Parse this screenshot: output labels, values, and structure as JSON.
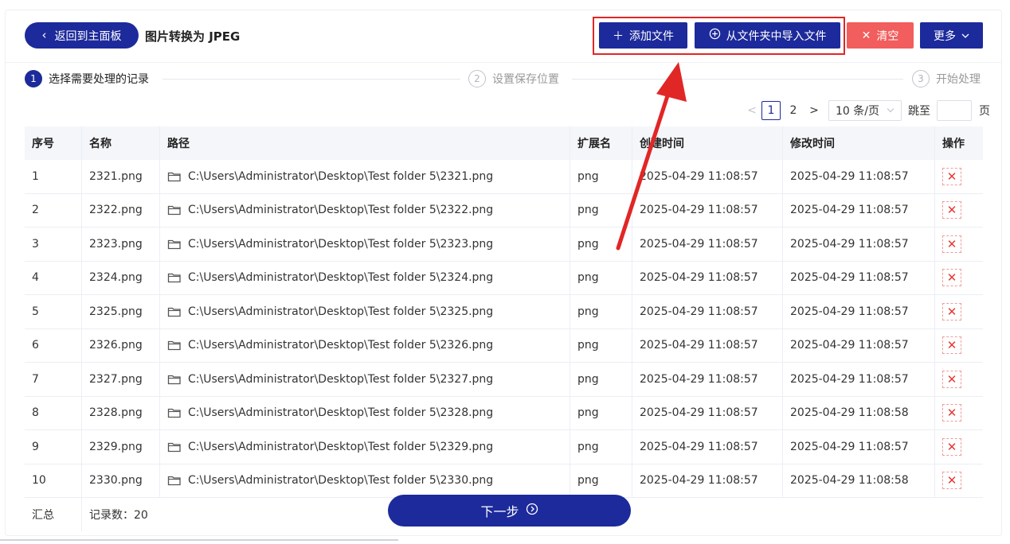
{
  "header": {
    "back_label": "返回到主面板",
    "title": "图片转换为 JPEG",
    "add_file_label": "添加文件",
    "import_folder_label": "从文件夹中导入文件",
    "clear_label": "清空",
    "more_label": "更多"
  },
  "steps": [
    {
      "num": "1",
      "label": "选择需要处理的记录"
    },
    {
      "num": "2",
      "label": "设置保存位置"
    },
    {
      "num": "3",
      "label": "开始处理"
    }
  ],
  "pagination": {
    "prev": "<",
    "pages": [
      "1",
      "2"
    ],
    "current": "1",
    "next": ">",
    "page_size": "10 条/页",
    "jump_label": "跳至",
    "jump_value": "",
    "unit": "页"
  },
  "table": {
    "columns": [
      "序号",
      "名称",
      "路径",
      "扩展名",
      "创建时间",
      "修改时间",
      "操作"
    ],
    "rows": [
      {
        "no": "1",
        "name": "2321.png",
        "path": "C:\\Users\\Administrator\\Desktop\\Test folder 5\\2321.png",
        "ext": "png",
        "created": "2025-04-29 11:08:57",
        "modified": "2025-04-29 11:08:57"
      },
      {
        "no": "2",
        "name": "2322.png",
        "path": "C:\\Users\\Administrator\\Desktop\\Test folder 5\\2322.png",
        "ext": "png",
        "created": "2025-04-29 11:08:57",
        "modified": "2025-04-29 11:08:57"
      },
      {
        "no": "3",
        "name": "2323.png",
        "path": "C:\\Users\\Administrator\\Desktop\\Test folder 5\\2323.png",
        "ext": "png",
        "created": "2025-04-29 11:08:57",
        "modified": "2025-04-29 11:08:57"
      },
      {
        "no": "4",
        "name": "2324.png",
        "path": "C:\\Users\\Administrator\\Desktop\\Test folder 5\\2324.png",
        "ext": "png",
        "created": "2025-04-29 11:08:57",
        "modified": "2025-04-29 11:08:57"
      },
      {
        "no": "5",
        "name": "2325.png",
        "path": "C:\\Users\\Administrator\\Desktop\\Test folder 5\\2325.png",
        "ext": "png",
        "created": "2025-04-29 11:08:57",
        "modified": "2025-04-29 11:08:57"
      },
      {
        "no": "6",
        "name": "2326.png",
        "path": "C:\\Users\\Administrator\\Desktop\\Test folder 5\\2326.png",
        "ext": "png",
        "created": "2025-04-29 11:08:57",
        "modified": "2025-04-29 11:08:57"
      },
      {
        "no": "7",
        "name": "2327.png",
        "path": "C:\\Users\\Administrator\\Desktop\\Test folder 5\\2327.png",
        "ext": "png",
        "created": "2025-04-29 11:08:57",
        "modified": "2025-04-29 11:08:57"
      },
      {
        "no": "8",
        "name": "2328.png",
        "path": "C:\\Users\\Administrator\\Desktop\\Test folder 5\\2328.png",
        "ext": "png",
        "created": "2025-04-29 11:08:57",
        "modified": "2025-04-29 11:08:58"
      },
      {
        "no": "9",
        "name": "2329.png",
        "path": "C:\\Users\\Administrator\\Desktop\\Test folder 5\\2329.png",
        "ext": "png",
        "created": "2025-04-29 11:08:57",
        "modified": "2025-04-29 11:08:57"
      },
      {
        "no": "10",
        "name": "2330.png",
        "path": "C:\\Users\\Administrator\\Desktop\\Test folder 5\\2330.png",
        "ext": "png",
        "created": "2025-04-29 11:08:57",
        "modified": "2025-04-29 11:08:58"
      }
    ],
    "footer": {
      "label": "汇总",
      "count_label": "记录数：20"
    }
  },
  "next_button": {
    "label": "下一步"
  },
  "icons": {
    "back": "chevron-left-icon",
    "add": "plus-icon",
    "import": "circle-plus-icon",
    "clear": "close-icon",
    "more": "chevron-down-icon",
    "folder": "folder-icon",
    "delete": "delete-x-icon",
    "next": "circle-arrow-right-icon"
  },
  "colors": {
    "primary": "#1d2a9b",
    "danger": "#f25d5d",
    "annotation": "#e12626"
  }
}
